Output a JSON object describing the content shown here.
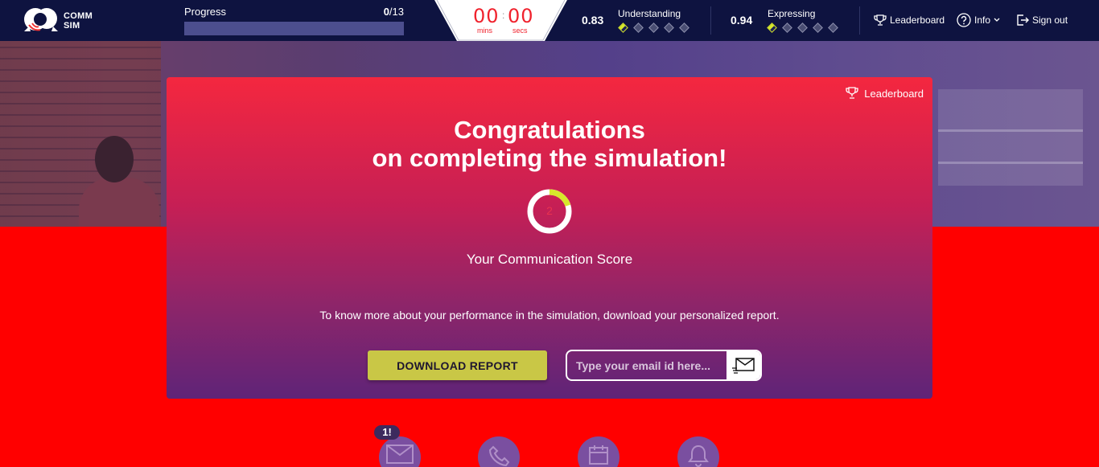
{
  "app": {
    "logo_line1": "COMM",
    "logo_line2": "SIM"
  },
  "progress": {
    "label": "Progress",
    "current": "0",
    "total": "/13",
    "fraction": 0
  },
  "timer": {
    "mins": "00",
    "colon": ":",
    "secs": "00",
    "mins_label": "mins",
    "secs_label": "secs"
  },
  "metrics": {
    "understanding": {
      "value": "0.83",
      "label": "Understanding",
      "filled": 0.5,
      "diamonds": 5
    },
    "expressing": {
      "value": "0.94",
      "label": "Expressing",
      "filled": 0.5,
      "diamonds": 5
    }
  },
  "nav": {
    "leaderboard": "Leaderboard",
    "info": "Info",
    "signout": "Sign out"
  },
  "modal": {
    "leaderboard_link": "Leaderboard",
    "title_line1": "Congratulations",
    "title_line2": "on completing the simulation!",
    "score": "2",
    "score_fraction": 0.2,
    "score_label": "Your Communication Score",
    "info_text": "To know more about your performance in the simulation, download your personalized report.",
    "download_label": "DOWNLOAD REPORT",
    "email_placeholder": "Type your email id here..."
  },
  "dock": {
    "badge": "1!",
    "icons": [
      "mail-icon",
      "phone-icon",
      "calendar-icon",
      "bell-icon"
    ]
  },
  "colors": {
    "topbar": "#0e1340",
    "accent_red": "#f0222d",
    "lime": "#d7e82b",
    "button": "#c9c746"
  }
}
